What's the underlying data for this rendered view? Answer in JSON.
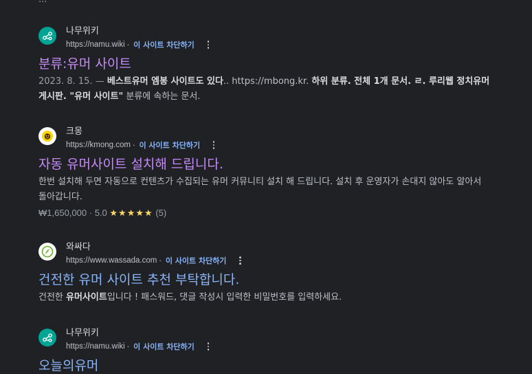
{
  "top_fragment": "...",
  "results": [
    {
      "site_name": "나무위키",
      "url": "https://namu.wiki",
      "url_sep": "·",
      "block_label": "이 사이트 차단하기",
      "title": "분류:유머 사이트",
      "title_state": "visited",
      "snippet_date": "2023. 8. 15. —",
      "snippet_parts": [
        {
          "text": "베스트유머 엠봉 사이트도 있다",
          "bold": true
        },
        {
          "text": ".. https://mbong.kr. ",
          "bold": false
        },
        {
          "text": "하위 분류. 전체 1개 문서. ㄹ. 루리웹 정치유머 게시판. \"유머 사이트\"",
          "bold": true
        },
        {
          "text": " 분류에 속하는 문서.",
          "bold": false
        }
      ]
    },
    {
      "site_name": "크몽",
      "url": "https://kmong.com",
      "url_sep": "·",
      "block_label": "이 사이트 차단하기",
      "title": "자동 유머사이트 설치해 드립니다.",
      "title_state": "visited",
      "snippet_parts": [
        {
          "text": "한번 설치해 두면 자동으로 컨텐츠가 수집되는 유머 커뮤니티 설치 해 드립니다. 설치 후 운영자가 손대지 않아도 알아서 돌아갑니다.",
          "bold": false
        }
      ],
      "price": "₩1,650,000",
      "rating_sep": "·",
      "rating_value": "5.0",
      "stars": "★★★★★",
      "review_count": "(5)"
    },
    {
      "site_name": "와싸다",
      "url": "https://www.wassada.com",
      "url_sep": "·",
      "block_label": "이 사이트 차단하기",
      "title": "건전한 유머 사이트 추천 부탁합니다.",
      "title_state": "unvisited",
      "snippet_parts": [
        {
          "text": "건전한 ",
          "bold": false
        },
        {
          "text": "유머사이트",
          "bold": true
        },
        {
          "text": "입니다 ! 패스워드, 댓글 작성시 입력한 비밀번호를 입력하세요.",
          "bold": false
        }
      ]
    },
    {
      "site_name": "나무위키",
      "url": "https://namu.wiki",
      "url_sep": "·",
      "block_label": "이 사이트 차단하기",
      "title": "오늘의유머",
      "title_state": "unvisited"
    }
  ],
  "icons": {
    "namu": "namu-wiki-favicon",
    "kmong": "kmong-favicon",
    "wassada": "wassada-favicon",
    "more": "more-vert-icon"
  },
  "colors": {
    "background": "#202124",
    "link_visited": "#c58af9",
    "link_unvisited": "#8ab4f8",
    "block_link": "#8ab4f8",
    "star": "#fdd663"
  }
}
